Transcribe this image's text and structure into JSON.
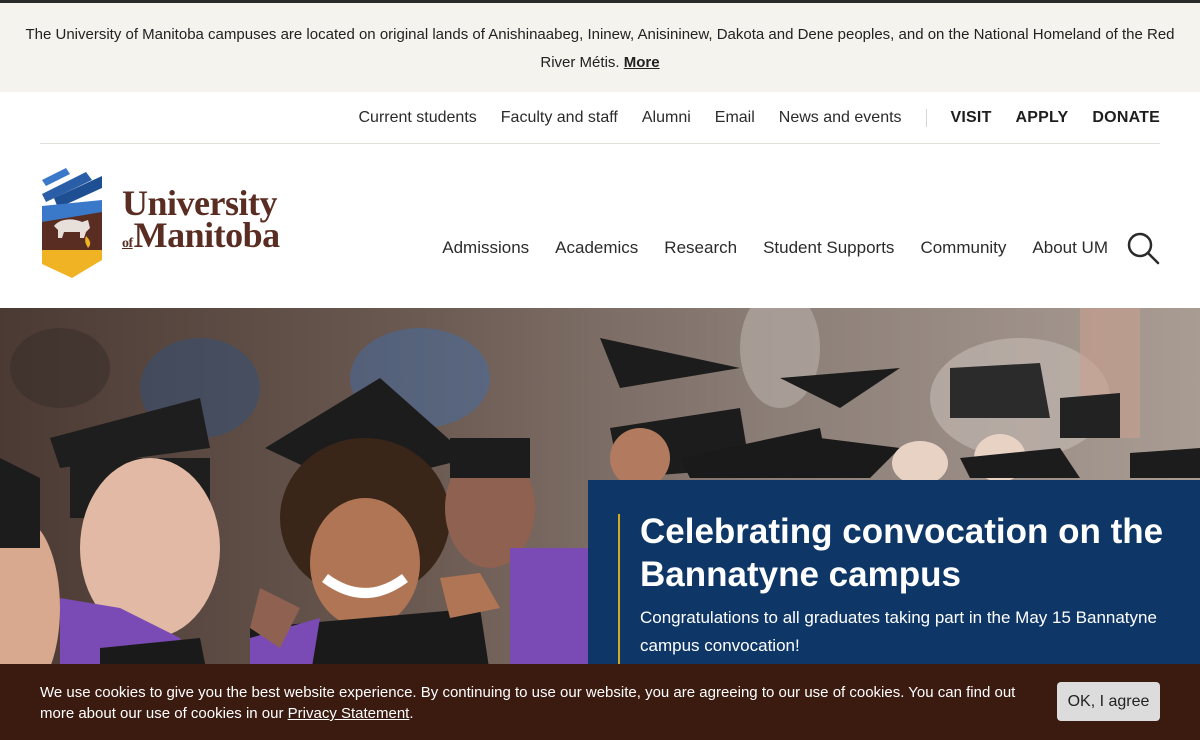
{
  "land_acknowledgement": {
    "text": "The University of Manitoba campuses are located on original lands of Anishinaabeg, Ininew, Anisininew, Dakota and Dene peoples, and on the National Homeland of the Red River Métis.",
    "more_link": "More"
  },
  "utility_nav": {
    "links": [
      "Current students",
      "Faculty and staff",
      "Alumni",
      "Email",
      "News and events"
    ],
    "cta": [
      "VISIT",
      "APPLY",
      "DONATE"
    ]
  },
  "logo": {
    "line1": "University",
    "of": "of",
    "line2": "Manitoba",
    "colors": {
      "text": "#5a2d22",
      "blue": "#3a78c9",
      "gold": "#f0b323",
      "brown": "#5a2d22"
    }
  },
  "main_nav": {
    "items": [
      "Admissions",
      "Academics",
      "Research",
      "Student Supports",
      "Community",
      "About UM"
    ],
    "search_icon": "search-icon"
  },
  "hero": {
    "headline": "Celebrating convocation on the Bannatyne campus",
    "description": "Congratulations to all graduates taking part in the May 15 Bannatyne campus convocation!",
    "colors": {
      "panel": "#0e3768",
      "accent": "#d4a91c"
    }
  },
  "cookie_banner": {
    "text_before": "We use cookies to give you the best website experience. By continuing to use our website, you are agreeing to our use of cookies. You can find out more about our use of cookies in our ",
    "link": "Privacy Statement",
    "text_after": ".",
    "button": "OK, I agree",
    "colors": {
      "background": "#3b1a10"
    }
  }
}
